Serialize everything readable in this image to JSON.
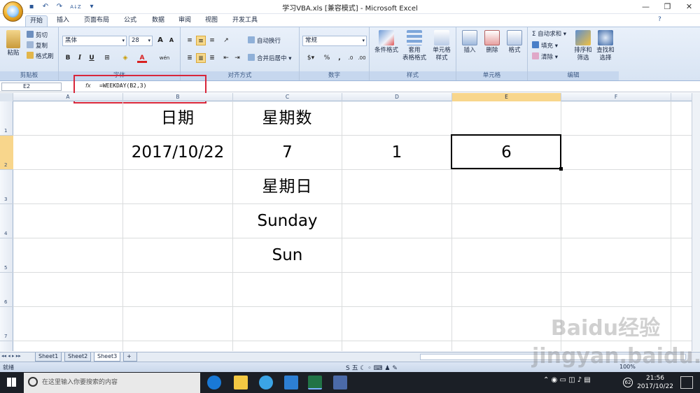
{
  "window": {
    "title": "学习VBA.xls  [兼容模式] - Microsoft Excel"
  },
  "qat": {
    "undo_icon": "↶",
    "redo_icon": "↷",
    "sort_icon": "A↓Z",
    "more_icon": "▾"
  },
  "tabs": [
    "开始",
    "插入",
    "页面布局",
    "公式",
    "数据",
    "审阅",
    "视图",
    "开发工具"
  ],
  "ribbon": {
    "clipboard": {
      "label": "剪贴板",
      "paste": "粘贴",
      "cut": "剪切",
      "copy": "复制",
      "painter": "格式刷"
    },
    "font": {
      "label": "字体",
      "name": "黑体",
      "size": "28",
      "bold": "B",
      "italic": "I",
      "underline": "U",
      "grow": "A",
      "shrink": "A",
      "wen": "wén"
    },
    "alignment": {
      "label": "对齐方式",
      "wrap": "自动换行",
      "merge": "合并后居中"
    },
    "number": {
      "label": "数字",
      "format": "常规",
      "percent": "%",
      "comma": ","
    },
    "styles": {
      "label": "样式",
      "conditional": "条件格式",
      "table_l1": "套用",
      "table_l2": "表格格式",
      "cell_l1": "单元格",
      "cell_l2": "样式"
    },
    "cells": {
      "label": "单元格",
      "insert": "插入",
      "delete": "删除",
      "format": "格式"
    },
    "editing": {
      "label": "编辑",
      "autosum": "自动求和",
      "fill": "填充",
      "clear": "清除",
      "sort_l1": "排序和",
      "sort_l2": "筛选",
      "find_l1": "查找和",
      "find_l2": "选择"
    }
  },
  "formula_bar": {
    "name_box": "E2",
    "fx": "fx",
    "formula": "=WEEKDAY(B2,3)"
  },
  "columns": [
    "A",
    "B",
    "C",
    "D",
    "E",
    "F"
  ],
  "rows": [
    "1",
    "2",
    "3",
    "4",
    "5",
    "6",
    "7"
  ],
  "cells": {
    "B1": "日期",
    "C1": "星期数",
    "B2": "2017/10/22",
    "C2": "7",
    "D2": "1",
    "E2": "6",
    "C3": "星期日",
    "C4": "Sunday",
    "C5": "Sun"
  },
  "sheets": [
    "Sheet1",
    "Sheet2",
    "Sheet3"
  ],
  "status": {
    "ready": "就绪",
    "zoom": "100%"
  },
  "taskbar": {
    "search_placeholder": "在这里输入你要搜索的内容",
    "time": "21:56",
    "date": "2017/10/22",
    "notif_count": "62"
  },
  "watermark": "Baidu经验 jingyan.baidu.com"
}
